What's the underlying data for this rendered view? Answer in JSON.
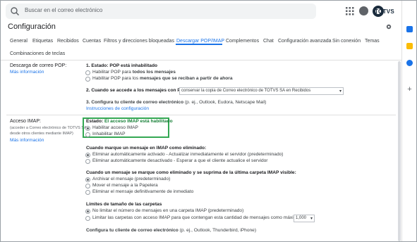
{
  "header": {
    "search_placeholder": "Buscar en el correo electrónico",
    "brand": "TOTVS"
  },
  "page": {
    "title": "Configuración"
  },
  "tabs": [
    "General",
    "Etiquetas",
    "Recibidos",
    "Cuentas",
    "Filtros y direcciones bloqueadas",
    "Descargar POP/IMAP",
    "Complementos",
    "Chat",
    "Configuración avanzada",
    "Sin conexión",
    "Temas",
    "Combinaciones de teclas"
  ],
  "pop": {
    "label": "Descarga de correo POP:",
    "more": "Más información",
    "status_prefix": "1. Estado: ",
    "status": "POP está inhabilitado",
    "opt1_a": "Habilitar POP para ",
    "opt1_b": "todos los mensajes",
    "opt2_a": "Habilitar POP para los ",
    "opt2_b": "mensajes que se reciban a partir de ahora",
    "step2_a": "2. Cuando se accede a los mensajes con POP",
    "step2_select": "conservar la copia de Correo electrónico de TOTVS SA en Recibidos",
    "step3_a": "3. Configura tu cliente de correo electrónico",
    "step3_b": " (p. ej., Outlook, Eudora, Netscape Mail)",
    "instructions": "Instrucciones de configuración"
  },
  "imap": {
    "label": "Acceso IMAP:",
    "sub1": "(acceder a Correo electrónico de TOTVS SA",
    "sub2": "desde otros clientes mediante IMAP)",
    "more": "Más información",
    "status_prefix": "Estado: ",
    "status": "El acceso IMAP está habilitado",
    "enable": "Habilitar acceso IMAP",
    "disable": "Inhabilitar IMAP",
    "deleted_title": "Cuando marque un mensaje en IMAP como eliminado:",
    "deleted_opt1": "Eliminar automáticamente activado - Actualizar inmediatamente el servidor (predeterminado)",
    "deleted_opt2": "Eliminar automáticamente desactivado - Esperar a que el cliente actualice el servidor",
    "expunge_title": "Cuando un mensaje se marque como eliminado y se suprima de la última carpeta IMAP visible:",
    "expunge_opt1": "Archivar el mensaje (predeterminado)",
    "expunge_opt2": "Mover el mensaje a la Papelera",
    "expunge_opt3": "Eliminar el mensaje definitivamente de inmediato",
    "limits_title": "Límites de tamaño de las carpetas",
    "limits_opt1": "No limitar el número de mensajes en una carpeta IMAP (predeterminado)",
    "limits_opt2": "Limitar las carpetas con acceso IMAP para que contengan esta cantidad de mensajes como máximo",
    "limits_select": "1,000",
    "client_a": "Configura tu cliente de correo electrónico",
    "client_b": " (p. ej., Outlook, Thunderbird, iPhone)"
  },
  "colors": {
    "accent": "#1a73e8",
    "highlight": "#34a853",
    "status_green": "#188038"
  },
  "icons": [
    "search-icon",
    "apps-grid-icon",
    "account-icon",
    "settings-gear-icon",
    "calendar-icon",
    "keep-icon",
    "tasks-icon",
    "add-icon"
  ]
}
